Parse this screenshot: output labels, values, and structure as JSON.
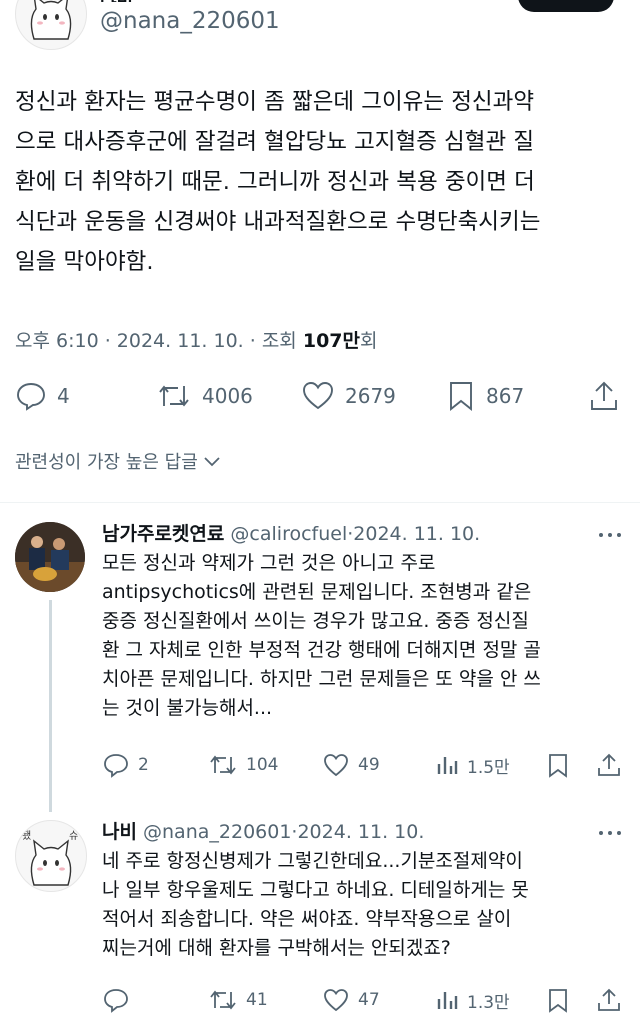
{
  "tweet": {
    "author_name": "나비",
    "handle": "@nana_220601",
    "text_lines": [
      "정신과 환자는 평균수명이 좀 짧은데 그이유는 정신과약",
      "으로 대사증후군에 잘걸려 혈압당뇨 고지혈증 심혈관 질",
      "환에 더 취약하기 때문. 그러니까 정신과 복용 중이면 더",
      "식단과 운동을 신경써야 내과적질환으로 수명단축시키는",
      "일을 막아야함."
    ],
    "time": "오후 6:10",
    "date": "2024. 11. 10.",
    "views_label": "조회",
    "views_count": "107만",
    "views_suffix": "회",
    "replies": "4",
    "retweets": "4006",
    "likes": "2679",
    "bookmarks": "867"
  },
  "relevance_label": "관련성이 가장 높은 답글",
  "reply1": {
    "name": "남가주로켓연료",
    "handle": "@calirocfuel",
    "date": "2024. 11. 10.",
    "text_lines": [
      "모든 정신과 약제가 그런 것은 아니고 주로",
      "antipsychotics에 관련된 문제입니다. 조현병과 같은",
      "중증 정신질환에서 쓰이는 경우가 많고요. 중증 정신질",
      "환 그 자체로 인한 부정적 건강 행태에 더해지면 정말 골",
      "치아픈 문제입니다. 하지만 그런 문제들은 또 약을 안 쓰",
      "는 것이 불가능해서..."
    ],
    "replies": "2",
    "retweets": "104",
    "likes": "49",
    "views": "1.5만"
  },
  "reply2": {
    "name": "나비",
    "handle": "@nana_220601",
    "date": "2024. 11. 10.",
    "avatar_text": "됐슈",
    "text_lines": [
      "네 주로 항정신병제가 그렇긴한데요...기분조절제약이",
      "나 일부 항우울제도 그렇다고 하네요. 디테일하게는 못",
      "적어서 죄송합니다. 약은 써야죠. 약부작용으로 살이",
      "찌는거에 대해 환자를 구박해서는 안되겠죠?"
    ],
    "replies": "",
    "retweets": "41",
    "likes": "47",
    "views": "1.3만"
  },
  "colors": {
    "text": "#0f1419",
    "secondary": "#536471",
    "divider": "#eff3f4"
  }
}
